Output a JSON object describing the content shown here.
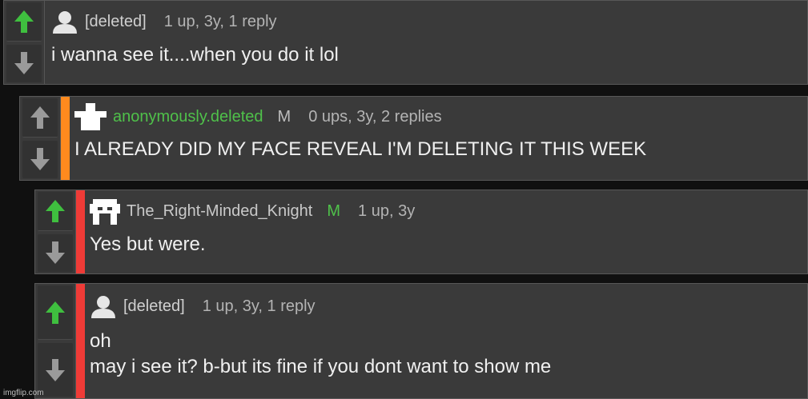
{
  "comments": [
    {
      "user": "[deleted]",
      "mod_badge": "",
      "stats": "1 up, 3y, 1 reply",
      "lines": [
        "i wanna see it....when you do it lol",
        ""
      ],
      "upvoted": true
    },
    {
      "user": "anonymously.deleted",
      "mod_badge": "M",
      "stats": "0 ups, 3y, 2 replies",
      "lines": [
        "I ALREADY DID MY FACE REVEAL I'M DELETING IT THIS WEEK",
        ""
      ],
      "upvoted": false,
      "stripe_color": "#ff8a1e"
    },
    {
      "user": "The_Right-Minded_Knight",
      "mod_badge": "M",
      "stats": "1 up, 3y",
      "lines": [
        "Yes but were.",
        ""
      ],
      "upvoted": true,
      "stripe_color": "#ef3b37"
    },
    {
      "user": "[deleted]",
      "mod_badge": "",
      "stats": "1 up, 3y, 1 reply",
      "lines": [
        "oh",
        "may i see it? b-but its fine if you dont want to show me"
      ],
      "upvoted": true,
      "stripe_color": "#ef3b37"
    }
  ],
  "watermark": "imgflip.com",
  "colors": {
    "upvote_active": "#3fbf3f",
    "arrow_inactive": "#9a9a9a",
    "username_green": "#4fc14a"
  }
}
